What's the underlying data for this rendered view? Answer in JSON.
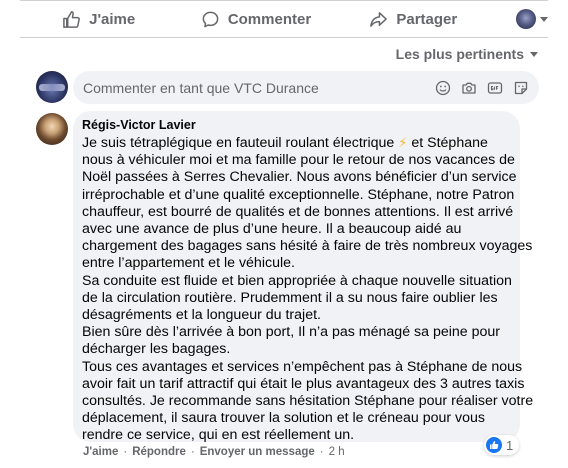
{
  "actions": {
    "like_label": "J'aime",
    "comment_label": "Commenter",
    "share_label": "Partager"
  },
  "sort": {
    "label": "Les plus pertinents"
  },
  "composer": {
    "placeholder": "Commenter en tant que VTC Durance"
  },
  "comment": {
    "author": "Régis-Victor Lavier",
    "lines": [
      "Je suis tétraplégique en fauteuil roulant électrique",
      "nous à véhiculer moi et ma famille pour le retour de nos vacances de",
      "Noël passées à Serres Chevalier. Nous avons bénéficier d’un service",
      "irréprochable et d’une qualité exceptionnelle. Stéphane, notre Patron",
      "chauffeur, est bourré de qualités et de bonnes attentions. Il est arrivé",
      "avec une avance de plus d’une heure. Il a beaucoup aidé au",
      "chargement des bagages sans hésité à faire de très nombreux voyages",
      "entre l’appartement et le véhicule.",
      "Sa conduite est fluide et bien appropriée à chaque nouvelle situation",
      "de la circulation routière. Prudemment il a su nous faire oublier les",
      "désagréments et la longueur du trajet.",
      "Bien sûre dès l’arrivée à bon port, Il n’a pas ménagé sa peine pour",
      "décharger les bagages.",
      "Tous ces avantages et services n’empêchent pas à Stéphane de nous",
      "avoir fait un tarif attractif qui était le plus avantageux des 3 autres taxis",
      "consultés. Je recommande sans hésitation Stéphane pour réaliser votre",
      "déplacement, il saura trouver la solution et le créneau pour vous",
      "rendre ce service, qui en est réellement un."
    ],
    "line1_emoji": "⚡",
    "line1_tail": " et Stéphane",
    "reaction_count": "1",
    "like_link": "J'aime",
    "reply_link": "Répondre",
    "message_link": "Envoyer un message",
    "separator": "·",
    "time": "2 h"
  },
  "colors": {
    "secondary_text": "#65676b",
    "bubble_bg": "#f0f2f5",
    "like_blue": "#1877f2"
  }
}
